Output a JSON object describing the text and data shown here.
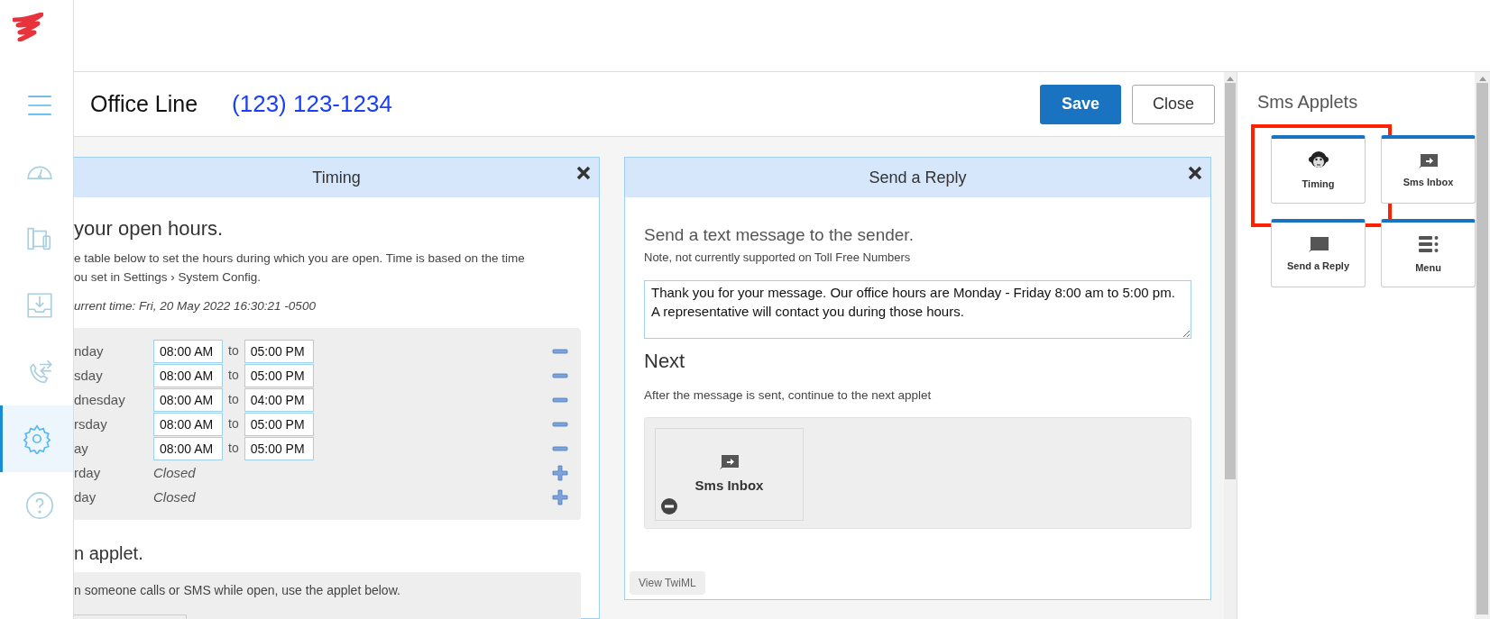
{
  "sidebar": {
    "items": [
      {
        "kind": "menu",
        "selected": false
      },
      {
        "kind": "gauge",
        "selected": false
      },
      {
        "kind": "devices",
        "selected": false
      },
      {
        "kind": "inbox",
        "selected": false
      },
      {
        "kind": "transfer",
        "selected": false
      },
      {
        "kind": "settings",
        "selected": true
      },
      {
        "kind": "help",
        "selected": false
      }
    ]
  },
  "header": {
    "title": "Office Line",
    "phone": "(123) 123-1234",
    "buttons": [
      {
        "label": "Save",
        "kind": "primary"
      },
      {
        "label": "Close",
        "kind": "secondary"
      }
    ]
  },
  "timing_panel": {
    "title": "Timing",
    "heading": "your open hours.",
    "description": "e table below to set the hours during which you are open. Time is based on the time ou set in Settings › System Config.",
    "current_time": "urrent time: Fri, 20 May 2022 16:30:21 -0500",
    "hours": [
      {
        "day": "nday",
        "open": true,
        "from": "08:00 AM",
        "separator": "to",
        "to": "05:00 PM"
      },
      {
        "day": "sday",
        "open": true,
        "from": "08:00 AM",
        "separator": "to",
        "to": "05:00 PM"
      },
      {
        "day": "dnesday",
        "open": true,
        "from": "08:00 AM",
        "separator": "to",
        "to": "04:00 PM"
      },
      {
        "day": "rsday",
        "open": true,
        "from": "08:00 AM",
        "separator": "to",
        "to": "05:00 PM"
      },
      {
        "day": "ay",
        "open": true,
        "from": "08:00 AM",
        "separator": "to",
        "to": "05:00 PM"
      },
      {
        "day": "rday",
        "open": false,
        "status": "Closed"
      },
      {
        "day": "day",
        "open": false,
        "status": "Closed"
      }
    ],
    "applet_heading": "n applet.",
    "applet_description": "n someone calls or SMS while open, use the applet below."
  },
  "reply_panel": {
    "title": "Send a Reply",
    "heading": "Send a text message to the sender.",
    "note": "Note, not currently supported on Toll Free Numbers",
    "message": "Thank you for your message. Our office hours are Monday - Friday 8:00 am to 5:00 pm. A representative will contact you during those hours.",
    "next_heading": "Next",
    "next_description": "After the message is sent, continue to the next applet",
    "next_applet": {
      "label": "Sms Inbox",
      "kind": "inbox"
    },
    "view_button": "View TwiML"
  },
  "applets_panel": {
    "title": "Sms Applets",
    "applets": [
      {
        "label": "Timing",
        "kind": "timing",
        "highlighted": true
      },
      {
        "label": "Sms Inbox",
        "kind": "inbox",
        "highlighted": false
      },
      {
        "label": "Send a Reply",
        "kind": "reply",
        "highlighted": false
      },
      {
        "label": "Menu",
        "kind": "menu",
        "highlighted": false
      }
    ]
  }
}
